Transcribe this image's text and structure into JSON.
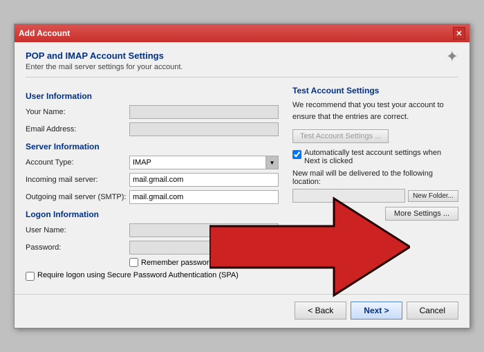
{
  "window": {
    "title": "Add Account",
    "close_label": "✕"
  },
  "header": {
    "title": "POP and IMAP Account Settings",
    "subtitle": "Enter the mail server settings for your account.",
    "icon": "✦"
  },
  "left": {
    "user_info_title": "User Information",
    "your_name_label": "Your Name:",
    "email_address_label": "Email Address:",
    "server_info_title": "Server Information",
    "account_type_label": "Account Type:",
    "account_type_value": "IMAP",
    "incoming_server_label": "Incoming mail server:",
    "incoming_server_value": "mail.gmail.com",
    "outgoing_server_label": "Outgoing mail server (SMTP):",
    "outgoing_server_value": "mail.gmail.com",
    "logon_info_title": "Logon Information",
    "username_label": "User Name:",
    "password_label": "Password:",
    "remember_password_label": "Remember password",
    "spa_label": "Require logon using Secure Password Authentication (SPA)"
  },
  "right": {
    "title": "Test Account Settings",
    "description": "We recommend that you test your account to ensure that the entries are correct.",
    "test_button_label": "Test Account Settings ...",
    "auto_test_label": "Automatically test account settings when Next is clicked",
    "deliver_label": "New mail will be delivered to the following location:",
    "deliver_placeholder": "",
    "new_folder_label": "New Folder...",
    "more_settings_label": "More Settings ..."
  },
  "footer": {
    "back_label": "< Back",
    "next_label": "Next >",
    "cancel_label": "Cancel"
  }
}
